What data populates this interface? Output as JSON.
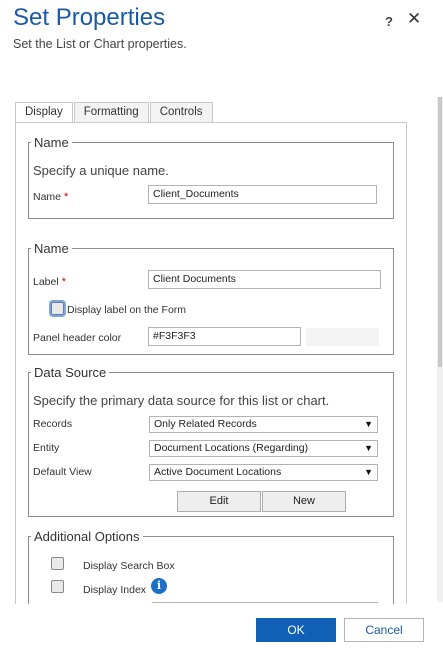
{
  "header": {
    "title": "Set Properties",
    "subtitle": "Set the List or Chart properties.",
    "help": "?",
    "close": "✕"
  },
  "tabs": [
    {
      "label": "Display",
      "active": true
    },
    {
      "label": "Formatting",
      "active": false
    },
    {
      "label": "Controls",
      "active": false
    }
  ],
  "name_section": {
    "legend": "Name",
    "hint": "Specify a unique name.",
    "name_label": "Name",
    "required_marker": "*",
    "name_value": "Client_Documents"
  },
  "label_section": {
    "legend": "Name",
    "label_label": "Label",
    "required_marker": "*",
    "label_value": "Client Documents",
    "display_label_text": "Display label on the Form",
    "display_label_checked": false,
    "panel_header_color_label": "Panel header color",
    "panel_header_color_value": "#F3F3F3",
    "panel_header_swatch": "#F3F3F3"
  },
  "data_source": {
    "legend": "Data Source",
    "hint": "Specify the primary data source for this list or chart.",
    "records_label": "Records",
    "records_value": "Only Related Records",
    "entity_label": "Entity",
    "entity_value": "Document Locations (Regarding)",
    "default_view_label": "Default View",
    "default_view_value": "Active Document Locations",
    "dropdown_arrow": "▼",
    "edit_button": "Edit",
    "new_button": "New"
  },
  "additional_options": {
    "legend": "Additional Options",
    "search_box_label": "Display Search Box",
    "search_box_checked": false,
    "index_label": "Display Index",
    "index_checked": false,
    "info_glyph": "i"
  },
  "footer": {
    "ok": "OK",
    "cancel": "Cancel"
  },
  "colors": {
    "accent": "#1160B7",
    "title": "#1A5AA5",
    "required": "#CC0000"
  }
}
